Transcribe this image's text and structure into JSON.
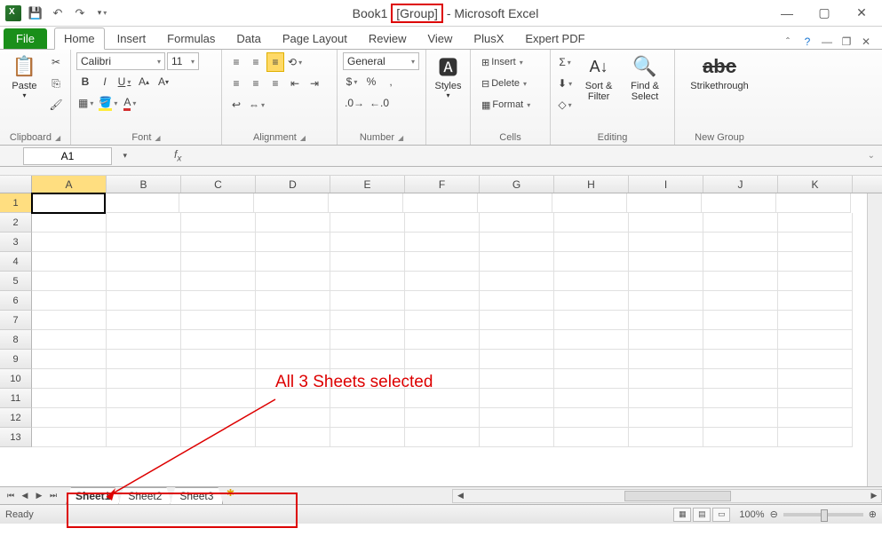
{
  "title": {
    "doc": "Book1",
    "group": "[Group]",
    "app": "Microsoft Excel"
  },
  "tabs": {
    "file": "File",
    "list": [
      "Home",
      "Insert",
      "Formulas",
      "Data",
      "Page Layout",
      "Review",
      "View",
      "PlusX",
      "Expert PDF"
    ],
    "active": "Home"
  },
  "ribbon": {
    "clipboard": {
      "label": "Clipboard",
      "paste": "Paste"
    },
    "font": {
      "label": "Font",
      "name": "Calibri",
      "size": "11",
      "bold": "B",
      "italic": "I",
      "underline": "U"
    },
    "alignment": {
      "label": "Alignment"
    },
    "number": {
      "label": "Number",
      "format": "General"
    },
    "styles": {
      "label": "Styles"
    },
    "cells": {
      "label": "Cells",
      "insert": "Insert",
      "delete": "Delete",
      "format": "Format"
    },
    "editing": {
      "label": "Editing",
      "sort": "Sort &",
      "filter": "Filter",
      "find": "Find &",
      "select": "Select"
    },
    "newgroup": {
      "label": "New Group",
      "strike": "Strikethrough"
    }
  },
  "namebox": "A1",
  "columns": [
    "A",
    "B",
    "C",
    "D",
    "E",
    "F",
    "G",
    "H",
    "I",
    "J",
    "K"
  ],
  "rows": [
    "1",
    "2",
    "3",
    "4",
    "5",
    "6",
    "7",
    "8",
    "9",
    "10",
    "11",
    "12",
    "13"
  ],
  "active_cell": "A1",
  "annotation": "All 3 Sheets selected",
  "sheets": [
    "Sheet1",
    "Sheet2",
    "Sheet3"
  ],
  "active_sheet": "Sheet1",
  "status": {
    "ready": "Ready",
    "zoom": "100%"
  }
}
